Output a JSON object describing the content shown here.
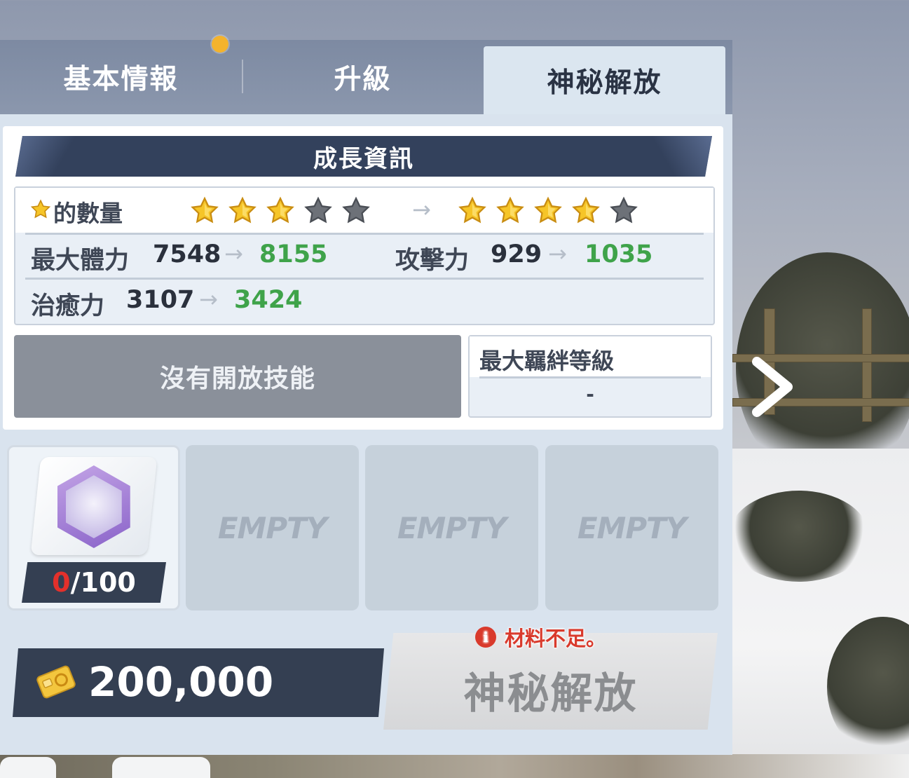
{
  "tabs": [
    {
      "label": "基本情報",
      "active": false,
      "has_notification": true
    },
    {
      "label": "升級",
      "active": false
    },
    {
      "label": "神秘解放",
      "active": true
    }
  ],
  "growth": {
    "header": "成長資訊",
    "star_count_label": "的數量",
    "stars_current": 3,
    "stars_next": 4,
    "stars_total": 5,
    "star_arrow": "→",
    "stats": {
      "hp": {
        "label": "最大體力",
        "current": "7548",
        "next": "8155"
      },
      "atk": {
        "label": "攻擊力",
        "current": "929",
        "next": "1035"
      },
      "heal": {
        "label": "治癒力",
        "current": "3107",
        "next": "3424"
      }
    },
    "arrow": "→",
    "no_skill_label": "沒有開放技能",
    "bond": {
      "label": "最大羈絆等級",
      "value": "-"
    }
  },
  "materials": {
    "item": {
      "have": "0",
      "need": "/100"
    },
    "empty_label": "EMPTY"
  },
  "cost": {
    "value": "200,000",
    "icon": "gold-ticket-icon"
  },
  "release": {
    "label": "神秘解放",
    "warning": "材料不足。",
    "warning_icon": "info-icon"
  },
  "colors": {
    "accent_dark": "#343f52",
    "stat_increase": "#3fa34a",
    "warning": "#d93a2c",
    "star_filled": "#f6c528",
    "star_empty": "#6d7178"
  }
}
